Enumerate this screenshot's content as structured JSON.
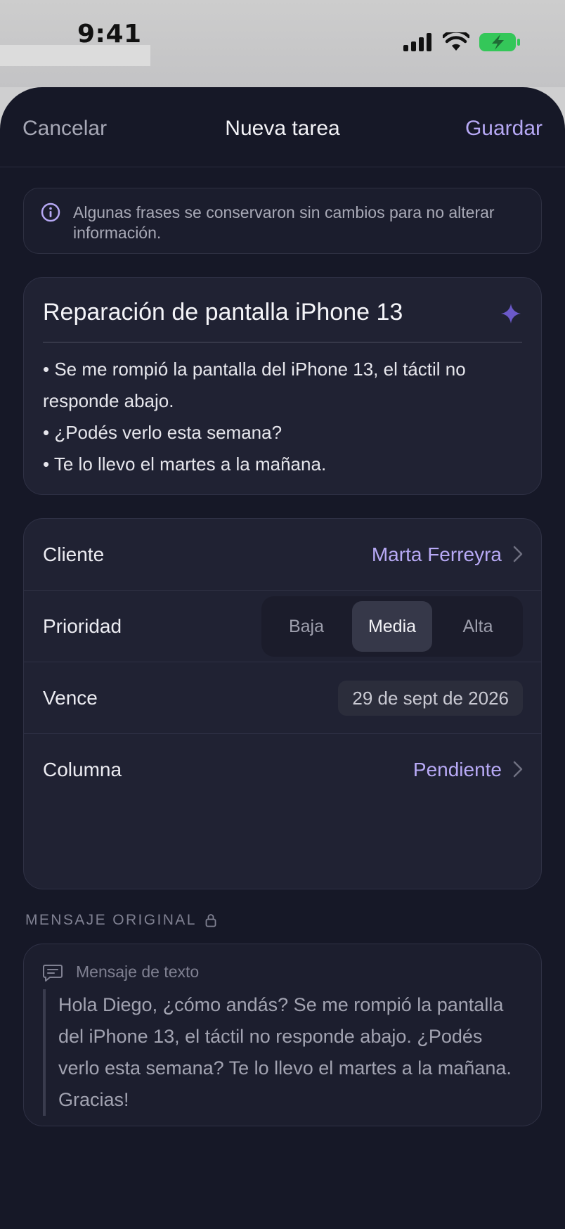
{
  "status": {
    "time": "9:41"
  },
  "nav": {
    "cancel": "Cancelar",
    "title": "Nueva tarea",
    "save": "Guardar"
  },
  "notice": {
    "icon": "info-icon",
    "text": "Algunas frases se conservaron sin cambios para no alterar información."
  },
  "task": {
    "title": "Reparación de pantalla iPhone 13",
    "lines": [
      "• Se me rompió la pantalla del iPhone 13, el táctil no responde abajo.",
      "• ¿Podés verlo esta semana?",
      "• Te lo llevo el martes a la mañana."
    ]
  },
  "fields": {
    "client": {
      "label": "Cliente",
      "value": "Marta Ferreyra"
    },
    "priority": {
      "label": "Prioridad",
      "options": [
        "Baja",
        "Media",
        "Alta"
      ],
      "selected": "Media"
    },
    "due": {
      "label": "Vence",
      "value": "29 de sept de 2026"
    },
    "column": {
      "label": "Columna",
      "value": "Pendiente"
    }
  },
  "original": {
    "section_label": "MENSAJE ORIGINAL",
    "source": "Mensaje de texto",
    "text": "Hola Diego, ¿cómo andás? Se me rompió la pantalla del iPhone 13, el táctil no responde abajo. ¿Podés verlo esta semana? Te lo llevo el martes a la mañana. Gracias!"
  },
  "colors": {
    "accent": "#b8aaf6",
    "background": "#161827",
    "card": "#202233"
  }
}
